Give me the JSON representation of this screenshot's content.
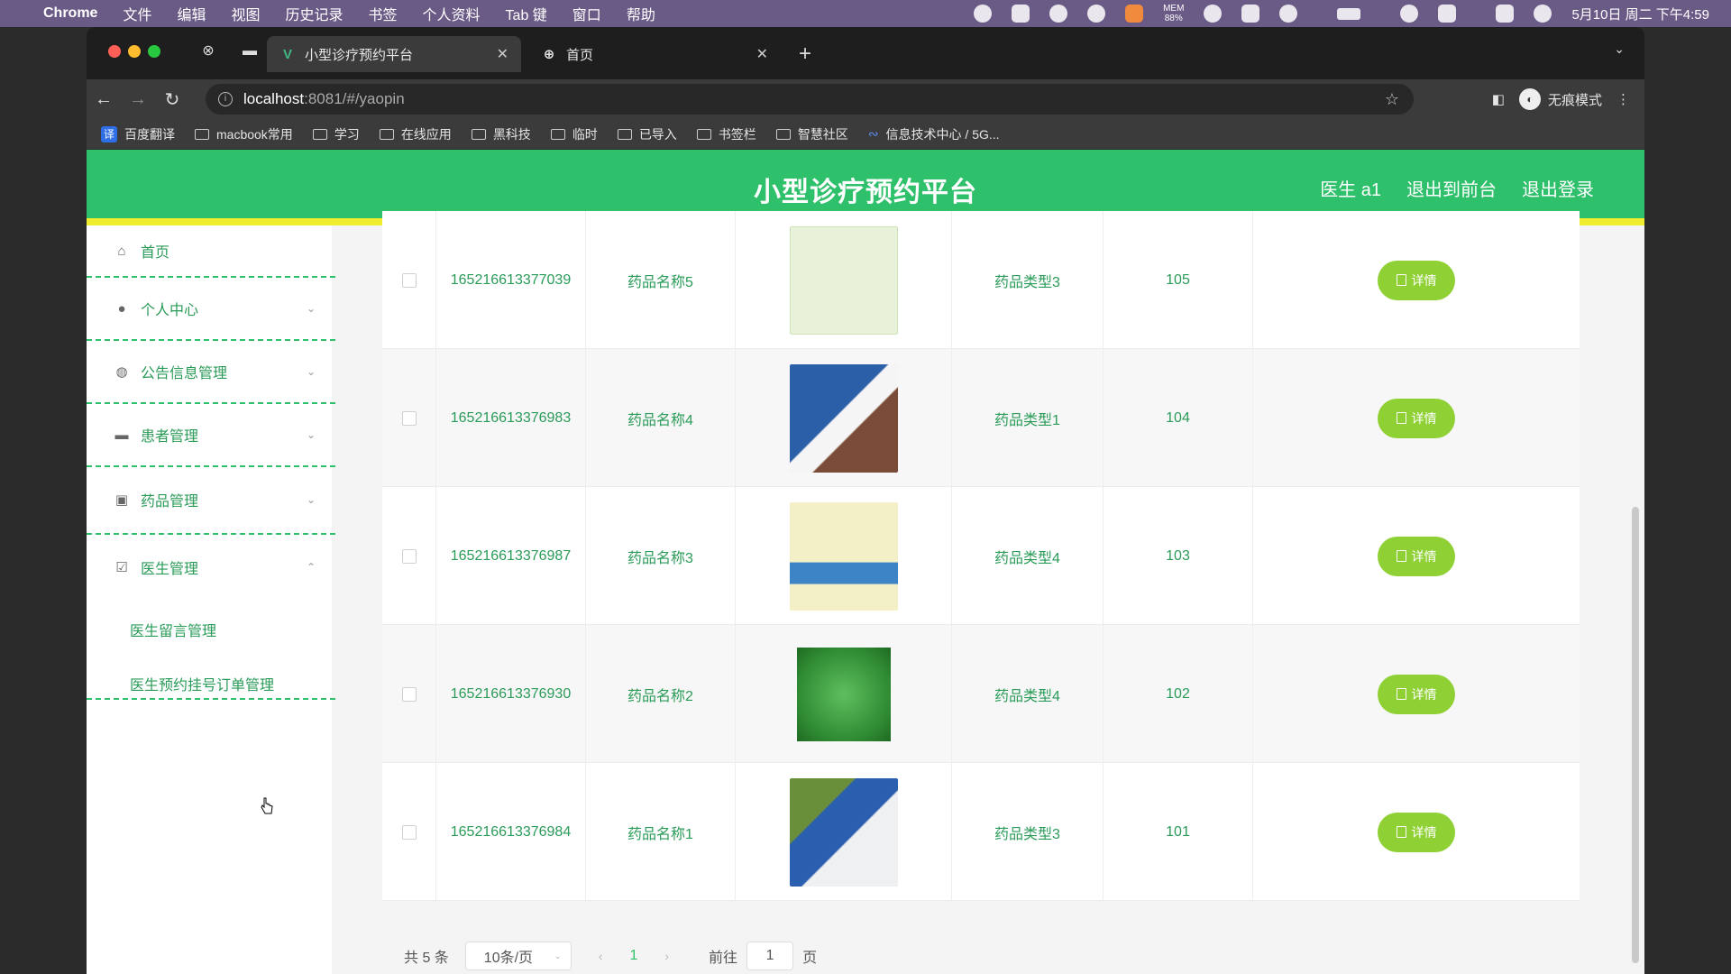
{
  "menubar": {
    "items": [
      "Chrome",
      "文件",
      "编辑",
      "视图",
      "历史记录",
      "书签",
      "个人资料",
      "Tab 键",
      "窗口",
      "帮助"
    ],
    "mem_label": "MEM",
    "mem_value": "88%",
    "datetime": "5月10日 周二 下午4:59"
  },
  "browser": {
    "tabs": [
      {
        "title": "小型诊疗预约平台",
        "active": true
      },
      {
        "title": "首页",
        "active": false
      }
    ],
    "url_host": "localhost",
    "url_path": ":8081/#/yaopin",
    "incognito_label": "无痕模式",
    "bookmarks": [
      "百度翻译",
      "macbook常用",
      "学习",
      "在线应用",
      "黑科技",
      "临时",
      "已导入",
      "书签栏",
      "智慧社区",
      "信息技术中心 / 5G..."
    ]
  },
  "header": {
    "title": "小型诊疗预约平台",
    "user": "医生 a1",
    "to_front": "退出到前台",
    "logout": "退出登录"
  },
  "sidebar": {
    "items": [
      {
        "label": "首页",
        "icon": "home-icon"
      },
      {
        "label": "个人中心",
        "icon": "user-icon"
      },
      {
        "label": "公告信息管理",
        "icon": "notice-icon"
      },
      {
        "label": "患者管理",
        "icon": "patient-icon"
      },
      {
        "label": "药品管理",
        "icon": "medicine-icon"
      },
      {
        "label": "医生管理",
        "icon": "doctor-icon"
      }
    ],
    "sub_items": [
      "医生留言管理",
      "医生预约挂号订单管理"
    ]
  },
  "table": {
    "detail_label": "详情",
    "rows": [
      {
        "id": "165216613377039",
        "name": "药品名称5",
        "type": "药品类型3",
        "no": "105",
        "color": "#e8f2d8"
      },
      {
        "id": "165216613376983",
        "name": "药品名称4",
        "type": "药品类型1",
        "no": "104",
        "color": "#7a4b36"
      },
      {
        "id": "165216613376987",
        "name": "药品名称3",
        "type": "药品类型4",
        "no": "103",
        "color": "#f3f0c8"
      },
      {
        "id": "165216613376930",
        "name": "药品名称2",
        "type": "药品类型4",
        "no": "102",
        "color": "#3a8a3a"
      },
      {
        "id": "165216613376984",
        "name": "药品名称1",
        "type": "药品类型3",
        "no": "101",
        "color": "#4f86c9"
      }
    ]
  },
  "pagination": {
    "total": "共 5 条",
    "page_size": "10条/页",
    "current": "1",
    "goto_label": "前往",
    "goto_value": "1",
    "unit": "页"
  },
  "colors": {
    "brand": "#2fc06b",
    "accent_bar": "#f0ec2e",
    "detail_button": "#8fd135"
  }
}
